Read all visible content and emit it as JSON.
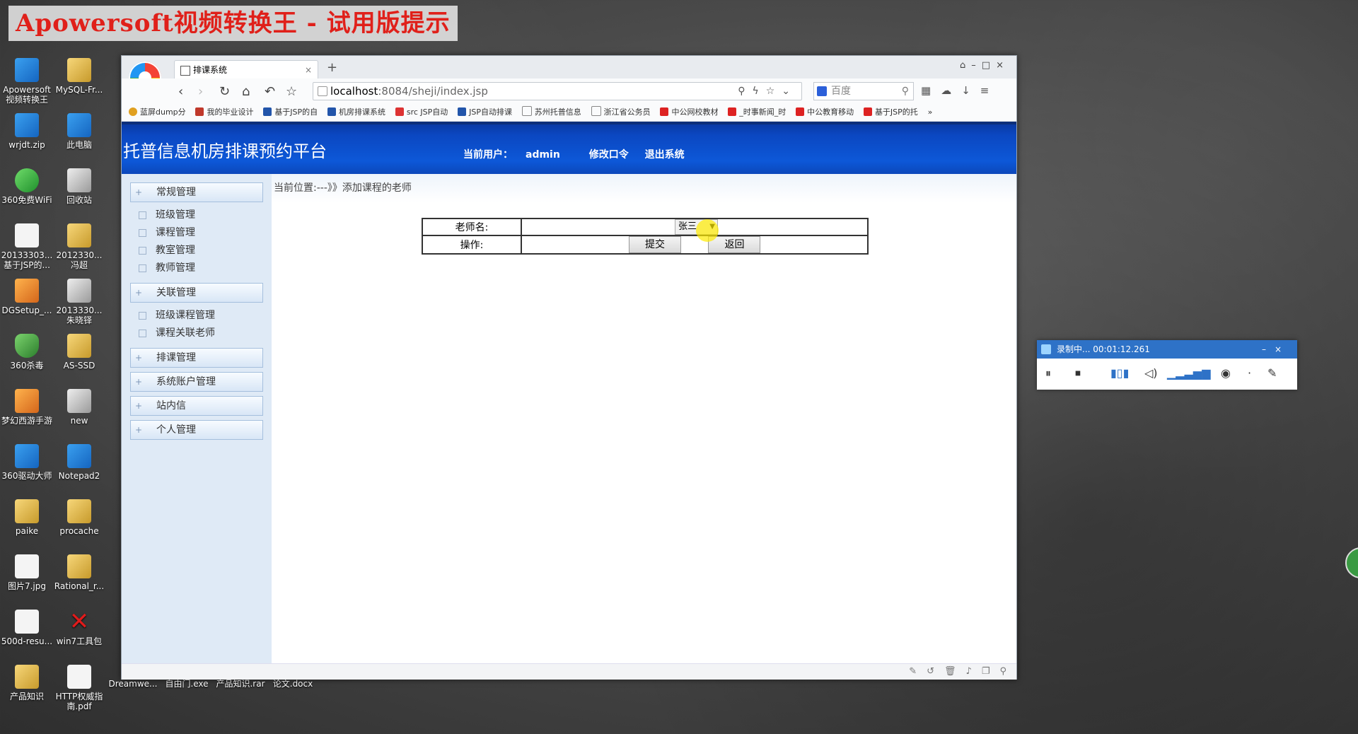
{
  "watermark": "Apowersoft视频转换王 - 试用版提示",
  "desktop_icons": {
    "apowersoft": "Apowersoft视频转换王",
    "mysql": "MySQL-Fr...",
    "wrjdt": "wrjdt.zip",
    "this_pc": "此电脑",
    "wifi": "360免费WiFi",
    "recycle": "回收站",
    "doc1": "20133303... 基于JSP的...",
    "doc2": "2012330... 冯超",
    "dgsetup": "DGSetup_...",
    "doc3": "2013330... 朱晓铎",
    "antivirus": "360杀毒",
    "asssd": "AS-SSD",
    "game": "梦幻西游手游",
    "new": "new",
    "driver": "360驱动大师",
    "notepad": "Notepad2",
    "paike": "paike",
    "procache": "procache",
    "pic": "图片7.jpg",
    "rational": "Rational_r...",
    "resu": "500d-resu...",
    "win7": "win7工具包",
    "product": "产品知识",
    "http": "HTTP权威指南.pdf",
    "dreamweaver": "Dreamwe...",
    "freegate": "自由门.exe",
    "product_rar": "产品知识.rar",
    "thesis": "论文.docx"
  },
  "browser": {
    "tab_title": "排课系统",
    "url_host": "localhost",
    "url_path": ":8084/sheji/index.jsp",
    "search_placeholder": "百度",
    "bookmarks": [
      "蓝屏dump分",
      "我的毕业设计",
      "基于JSP的自",
      "机房排课系统",
      "src JSP自动",
      "JSP自动排课",
      "苏州托普信息",
      "浙江省公务员",
      "中公网校教材",
      "_时事新闻_时",
      "中公教育移动",
      "基于JSP的托"
    ]
  },
  "site": {
    "title": "托普信息机房排课预约平台",
    "current_user_label": "当前用户：",
    "current_user": "admin",
    "change_password": "修改口令",
    "logout": "退出系统"
  },
  "sidebar": {
    "groups": [
      {
        "label": "常规管理",
        "items": [
          "班级管理",
          "课程管理",
          "教室管理",
          "教师管理"
        ]
      },
      {
        "label": "关联管理",
        "items": [
          "班级课程管理",
          "课程关联老师"
        ]
      },
      {
        "label": "排课管理",
        "items": []
      },
      {
        "label": "系统账户管理",
        "items": []
      },
      {
        "label": "站内信",
        "items": []
      },
      {
        "label": "个人管理",
        "items": []
      }
    ]
  },
  "main": {
    "breadcrumb": "当前位置:---》》添加课程的老师",
    "teacher_label": "老师名:",
    "teacher_value": "张三",
    "action_label": "操作:",
    "submit_label": "提交",
    "back_label": "返回"
  },
  "recorder": {
    "title": "录制中...",
    "time": "00:01:12.261"
  },
  "colors": {
    "header_blue": "#0b47c1",
    "sidebar_bg": "#dfeaf6",
    "watermark_red": "#e0201a",
    "recorder_blue": "#2e72c7"
  }
}
